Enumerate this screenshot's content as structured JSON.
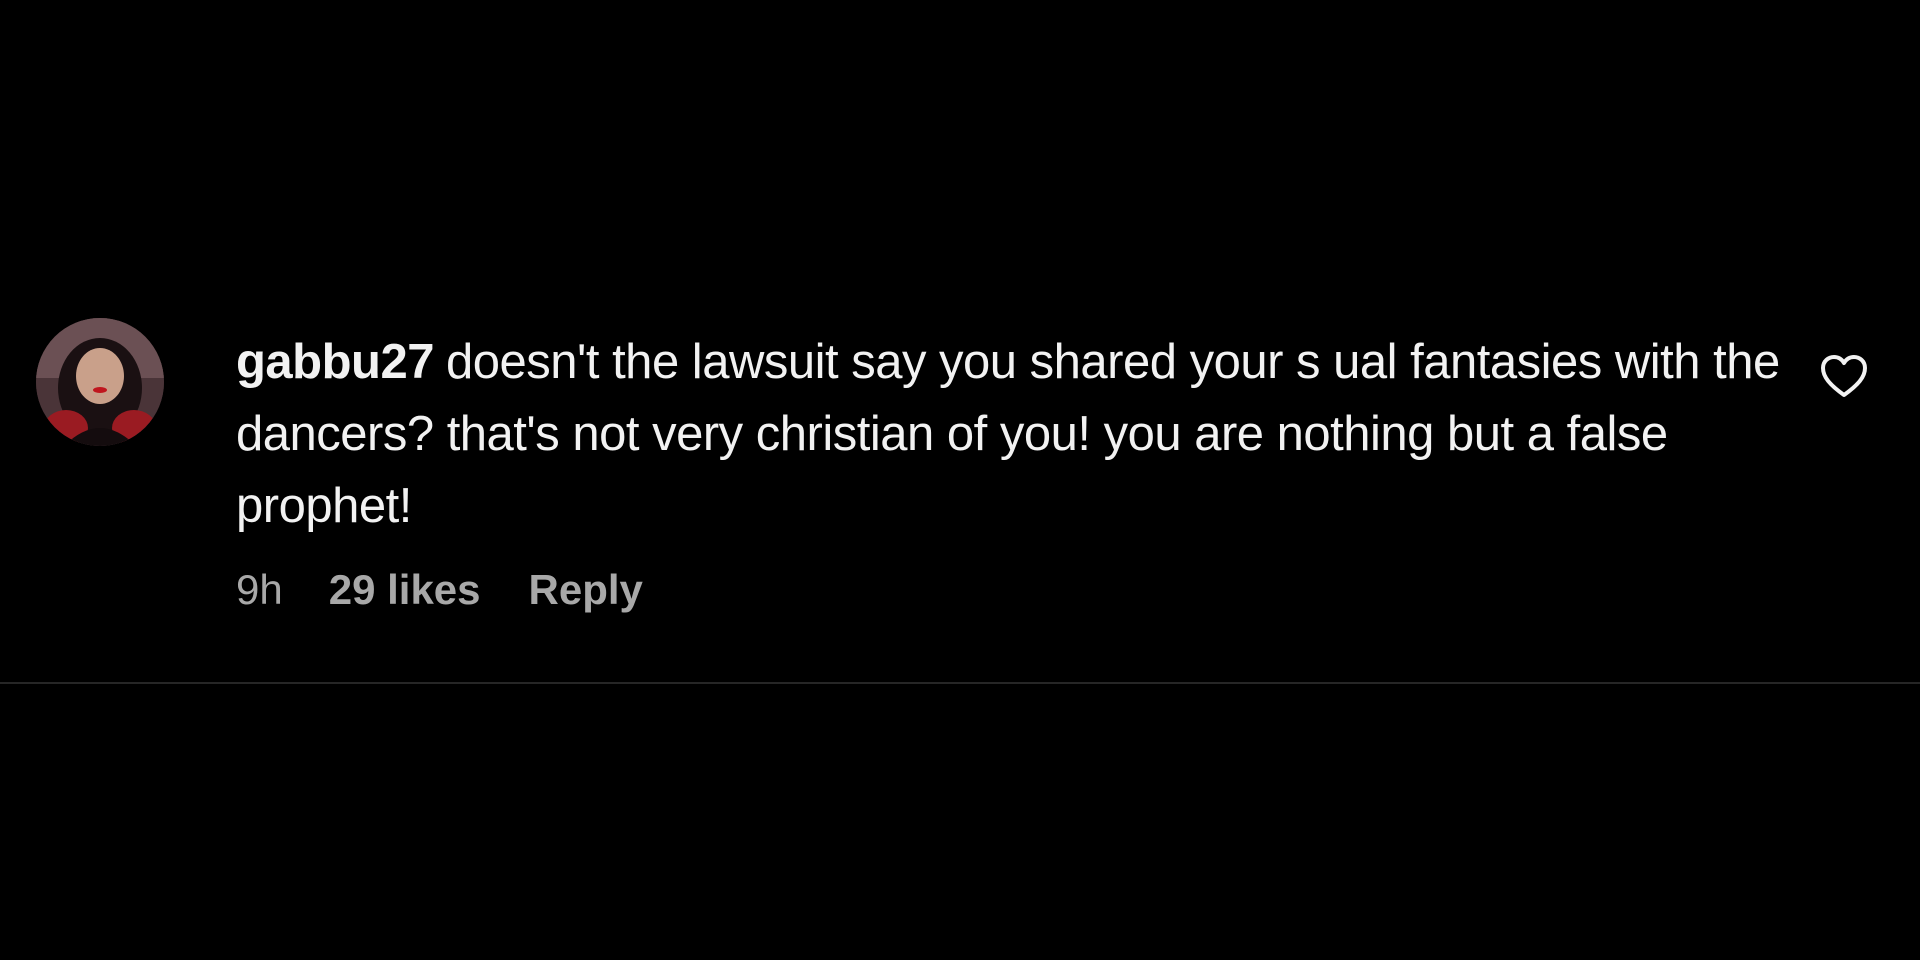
{
  "comment": {
    "username": "gabbu27",
    "text": "doesn't the lawsuit say you shared your s  ual fantasies with the dancers? that's not very christian of you! you are nothing but a false prophet!",
    "time": "9h",
    "likes": "29 likes",
    "reply_label": "Reply",
    "like_icon": "heart-outline-icon",
    "avatar_icon": "user-avatar"
  },
  "colors": {
    "background": "#000000",
    "text": "#f2f2f2",
    "meta_text": "#a8a8a8",
    "divider": "#262626"
  }
}
